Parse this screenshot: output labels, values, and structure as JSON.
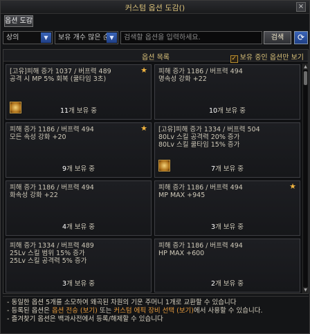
{
  "window": {
    "title": "커스텀 옵션 도감()",
    "close_glyph": "×"
  },
  "tabs": [
    {
      "label": "옵션 도감"
    }
  ],
  "search": {
    "grade_select": "상의",
    "sort_select": "보유 개수 많은 순",
    "placeholder": "검색할 옵션을 입력하세요.",
    "search_button": "검색",
    "refresh_glyph": "⟳"
  },
  "panel": {
    "header": "옵션 목록",
    "owned_only_label": "보유 중인 옵션만 보기",
    "owned_only_checked": true
  },
  "cards": [
    {
      "lines": [
        "[고유]피해 증가 1037 / 버프력 489",
        "공격 시 MP 5% 회복 (쿨타임 3초)"
      ],
      "count": "11",
      "count_suffix": "개 보유 중",
      "star": true,
      "icon": "gold-gem-icon"
    },
    {
      "lines": [
        "피해 증가 1186 / 버프력 494",
        "명속성 강화 +22"
      ],
      "count": "10",
      "count_suffix": "개 보유 중",
      "star": false,
      "icon": ""
    },
    {
      "lines": [
        "피해 증가 1186 / 버프력 494",
        "모든 속성 강화 +20"
      ],
      "count": "9",
      "count_suffix": "개 보유 중",
      "star": true,
      "icon": ""
    },
    {
      "lines": [
        "[고유]피해 증가 1334 / 버프력 504",
        "80Lv 스킬 공격력 20% 증가",
        "80Lv 스킬 쿨타임 15% 증가"
      ],
      "count": "7",
      "count_suffix": "개 보유 중",
      "star": false,
      "icon": "gold-gem-icon"
    },
    {
      "lines": [
        "피해 증가 1186 / 버프력 494",
        "화속성 강화 +22"
      ],
      "count": "4",
      "count_suffix": "개 보유 중",
      "star": false,
      "icon": ""
    },
    {
      "lines": [
        "피해 증가 1186 / 버프력 494",
        "MP MAX +945"
      ],
      "count": "3",
      "count_suffix": "개 보유 중",
      "star": true,
      "icon": ""
    },
    {
      "lines": [
        "피해 증가 1334 / 버프력 489",
        "25Lv 스킬 범위 15% 증가",
        "25Lv 스킬 공격력 5% 증가"
      ],
      "count": "3",
      "count_suffix": "개 보유 중",
      "star": false,
      "icon": ""
    },
    {
      "lines": [
        "피해 증가 1186 / 버프력 494",
        "HP MAX +600"
      ],
      "count": "2",
      "count_suffix": "개 보유 중",
      "star": false,
      "icon": ""
    }
  ],
  "notes": {
    "line1": "- 동일한 옵션 5개를 소모하여 왜곡된 차원의 기운 주머니 1개로 교환할 수 있습니다",
    "line2_a": "- 등록된 옵션은 ",
    "line2_b": "옵션 전승 (보기)",
    "line2_c": " 또는 ",
    "line2_d": "커스텀 에픽 장비 선택 (보기)",
    "line2_e": "에서 사용할 수 있습니다.",
    "line3": "- 즐겨찾기 옵션은 백과사전에서 등록/해제할 수 있습니다"
  },
  "colors": {
    "accent_gold": "#d9c17a",
    "link_orange": "#e99c3c",
    "star": "#f2b540",
    "blue_button": "#1f3f86"
  }
}
